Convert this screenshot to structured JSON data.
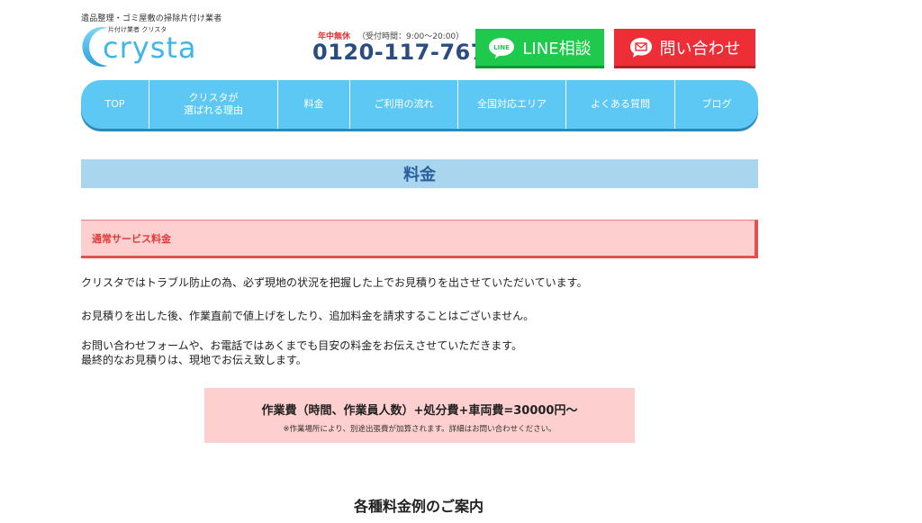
{
  "header": {
    "tagline": "遺品整理・ゴミ屋敷の掃除片付け業者",
    "logo_sub": "片付け業者 クリスタ",
    "logo_word": "crysta",
    "hours_label": "年中無休",
    "hours_detail": "（受付時間：9:00〜20:00）",
    "phone": "0120-117-767",
    "line_button": "LINE相談",
    "contact_button": "問い合わせ",
    "line_icon_text": "LINE"
  },
  "nav": {
    "items": [
      {
        "label": "TOP"
      },
      {
        "label": "クリスタが\n選ばれる理由"
      },
      {
        "label": "料金"
      },
      {
        "label": "ご利用の流れ"
      },
      {
        "label": "全国対応エリア"
      },
      {
        "label": "よくある質問"
      },
      {
        "label": "ブログ"
      }
    ]
  },
  "main": {
    "title": "料金",
    "section_heading": "通常サービス料金",
    "paragraphs": [
      "クリスタではトラブル防止の為、必ず現地の状況を把握した上でお見積りを出させていただいています。",
      "お見積りを出した後、作業直前で値上げをしたり、追加料金を請求することはございません。",
      "お問い合わせフォームや、お電話ではあくまでも目安の料金をお伝えさせていただきます。\n最終的なお見積りは、現地でお伝え致します。"
    ],
    "price_formula": "作業費（時間、作業員人数）+処分費+車両費=30000円〜",
    "price_note": "※作業場所により、別途出張費が加算されます。詳細はお問い合わせください。",
    "examples_heading": "各種料金例のご案内"
  },
  "colors": {
    "nav_bg": "#5ec8f4",
    "line_green": "#1ec94b",
    "contact_red": "#ee2e36",
    "title_bg": "#a9d6ee",
    "pink_bg": "#fdd0cf",
    "phone_navy": "#2b4c7e"
  },
  "icons": {
    "line": "line-chat-icon",
    "mail": "envelope-icon",
    "logo": "crescent-c-logo-icon"
  }
}
